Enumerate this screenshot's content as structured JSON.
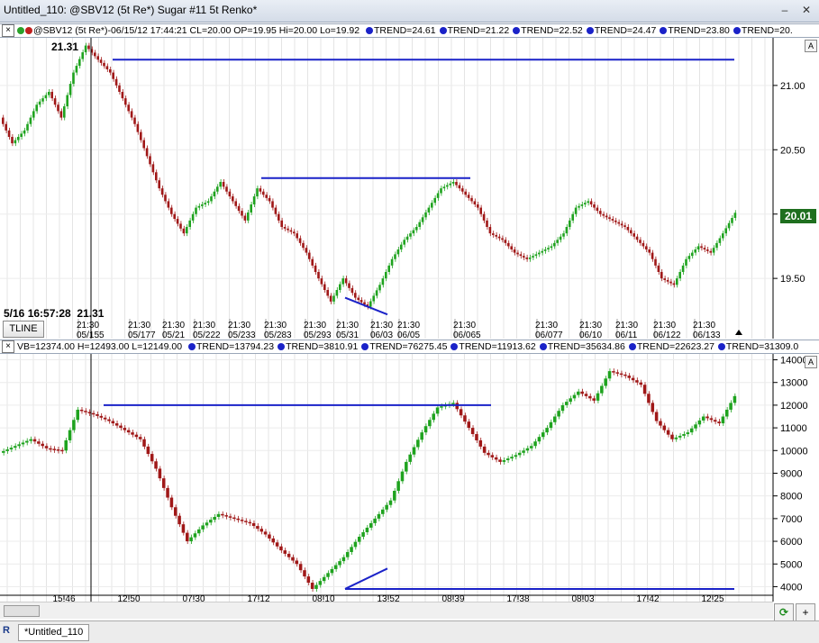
{
  "window": {
    "title": "Untitled_110: @SBV12 (5t Re*) Sugar #11 5t Renko*",
    "minimize": "–",
    "close": "✕"
  },
  "top_panel": {
    "header": "@SBV12 (5t Re*)-06/15/12 17:44:21 CL=20.00 OP=19.95 Hi=20.00 Lo=19.92",
    "trends": [
      "TREND=24.61",
      "TREND=21.22",
      "TREND=22.52",
      "TREND=24.47",
      "TREND=23.80",
      "TREND=20."
    ],
    "y_ticks": [
      "21.00",
      "20.50",
      "20.00",
      "19.50"
    ],
    "y_tick_values": [
      21.0,
      20.5,
      20.0,
      19.5
    ],
    "y_range": [
      19.2,
      21.3
    ],
    "high_label": "21.31",
    "cursor_info": "5/16 16:57:28",
    "cursor_price": "21.31",
    "last_price": "20.01",
    "date_labels": [
      {
        "time": "21:30",
        "date": "05/155"
      },
      {
        "time": "21:30",
        "date": "05/177"
      },
      {
        "time": "21:30",
        "date": "05/21"
      },
      {
        "time": "21:30",
        "date": "05/222"
      },
      {
        "time": "21:30",
        "date": "05/233"
      },
      {
        "time": "21:30",
        "date": "05/283"
      },
      {
        "time": "21:30",
        "date": "05/293"
      },
      {
        "time": "21:30",
        "date": "05/31"
      },
      {
        "time": "21:30",
        "date": "06/03"
      },
      {
        "time": "21:30",
        "date": "06/05"
      },
      {
        "time": "21:30",
        "date": "06/065"
      },
      {
        "time": "21:30",
        "date": "06/077"
      },
      {
        "time": "21:30",
        "date": "06/10"
      },
      {
        "time": "21:30",
        "date": "06/11"
      },
      {
        "time": "21:30",
        "date": "06/122"
      },
      {
        "time": "21:30",
        "date": "06/133"
      }
    ],
    "tline_button": "TLINE",
    "scale_button": "A"
  },
  "bottom_panel": {
    "header": "VB=12374.00 H=12493.00 L=12149.00",
    "trends": [
      "TREND=13794.23",
      "TREND=3810.91",
      "TREND=76275.45",
      "TREND=11913.62",
      "TREND=35634.86",
      "TREND=22623.27",
      "TREND=31309.0"
    ],
    "y_ticks": [
      "14000",
      "13000",
      "12000",
      "11000",
      "10000",
      "9000",
      "8000",
      "7000",
      "6000",
      "5000",
      "4000"
    ],
    "y_tick_values": [
      14000,
      13000,
      12000,
      11000,
      10000,
      9000,
      8000,
      7000,
      6000,
      5000,
      4000
    ],
    "y_range": [
      3700,
      14100
    ],
    "x_ticks": [
      "15:46",
      "12:50",
      "07:30",
      "17:12",
      "08:10",
      "13:52",
      "08:39",
      "17:38",
      "08:03",
      "17:42",
      "12:25"
    ],
    "scale_button": "A"
  },
  "tab": {
    "label": "*Untitled_110"
  },
  "buttons": {
    "refresh": "⟳",
    "add": "+"
  },
  "colors": {
    "up": "#1fa31f",
    "down": "#a01818",
    "trendline": "#1a22c8",
    "price_badge": "#1f6f1f"
  },
  "chart_data": [
    {
      "type": "renko-price",
      "xlabel": "",
      "ylabel": "",
      "ylim": [
        19.2,
        21.3
      ],
      "series": [
        {
          "values": [
            20.75,
            20.55,
            20.65,
            20.85,
            20.95,
            20.75,
            21.1,
            21.31,
            21.2,
            21.1,
            20.9,
            20.7,
            20.45,
            20.2,
            20.0,
            19.85,
            20.05,
            20.1,
            20.25,
            20.1,
            19.95,
            20.2,
            20.1,
            19.9,
            19.85,
            19.7,
            19.5,
            19.32,
            19.5,
            19.35,
            19.28,
            19.45,
            19.65,
            19.8,
            19.9,
            20.05,
            20.2,
            20.25,
            20.15,
            20.05,
            19.85,
            19.8,
            19.7,
            19.65,
            19.7,
            19.75,
            19.85,
            20.05,
            20.1,
            20.0,
            19.95,
            19.9,
            19.8,
            19.7,
            19.5,
            19.45,
            19.65,
            19.75,
            19.7,
            19.85,
            20.01
          ]
        }
      ],
      "trendlines_horizontal": [
        21.2,
        20.28
      ],
      "trendline_diagonal": [
        19.35,
        19.22
      ]
    },
    {
      "type": "renko-volume",
      "xlabel": "",
      "ylabel": "",
      "ylim": [
        3700,
        14100
      ],
      "series": [
        {
          "values": [
            9900,
            10200,
            10500,
            10100,
            10000,
            11800,
            11600,
            11300,
            10900,
            10500,
            9200,
            7500,
            6000,
            6700,
            7200,
            7000,
            6800,
            6300,
            5600,
            5000,
            3900,
            4600,
            5300,
            6200,
            7000,
            7800,
            9500,
            10800,
            11900,
            12100,
            11000,
            9900,
            9500,
            9800,
            10200,
            11000,
            12000,
            12600,
            12200,
            13500,
            13300,
            12900,
            11300,
            10500,
            10800,
            11500,
            11200,
            12400
          ]
        }
      ],
      "trendlines_horizontal": [
        12000,
        3900
      ],
      "trendline_diagonal": [
        3900,
        4800
      ]
    }
  ]
}
